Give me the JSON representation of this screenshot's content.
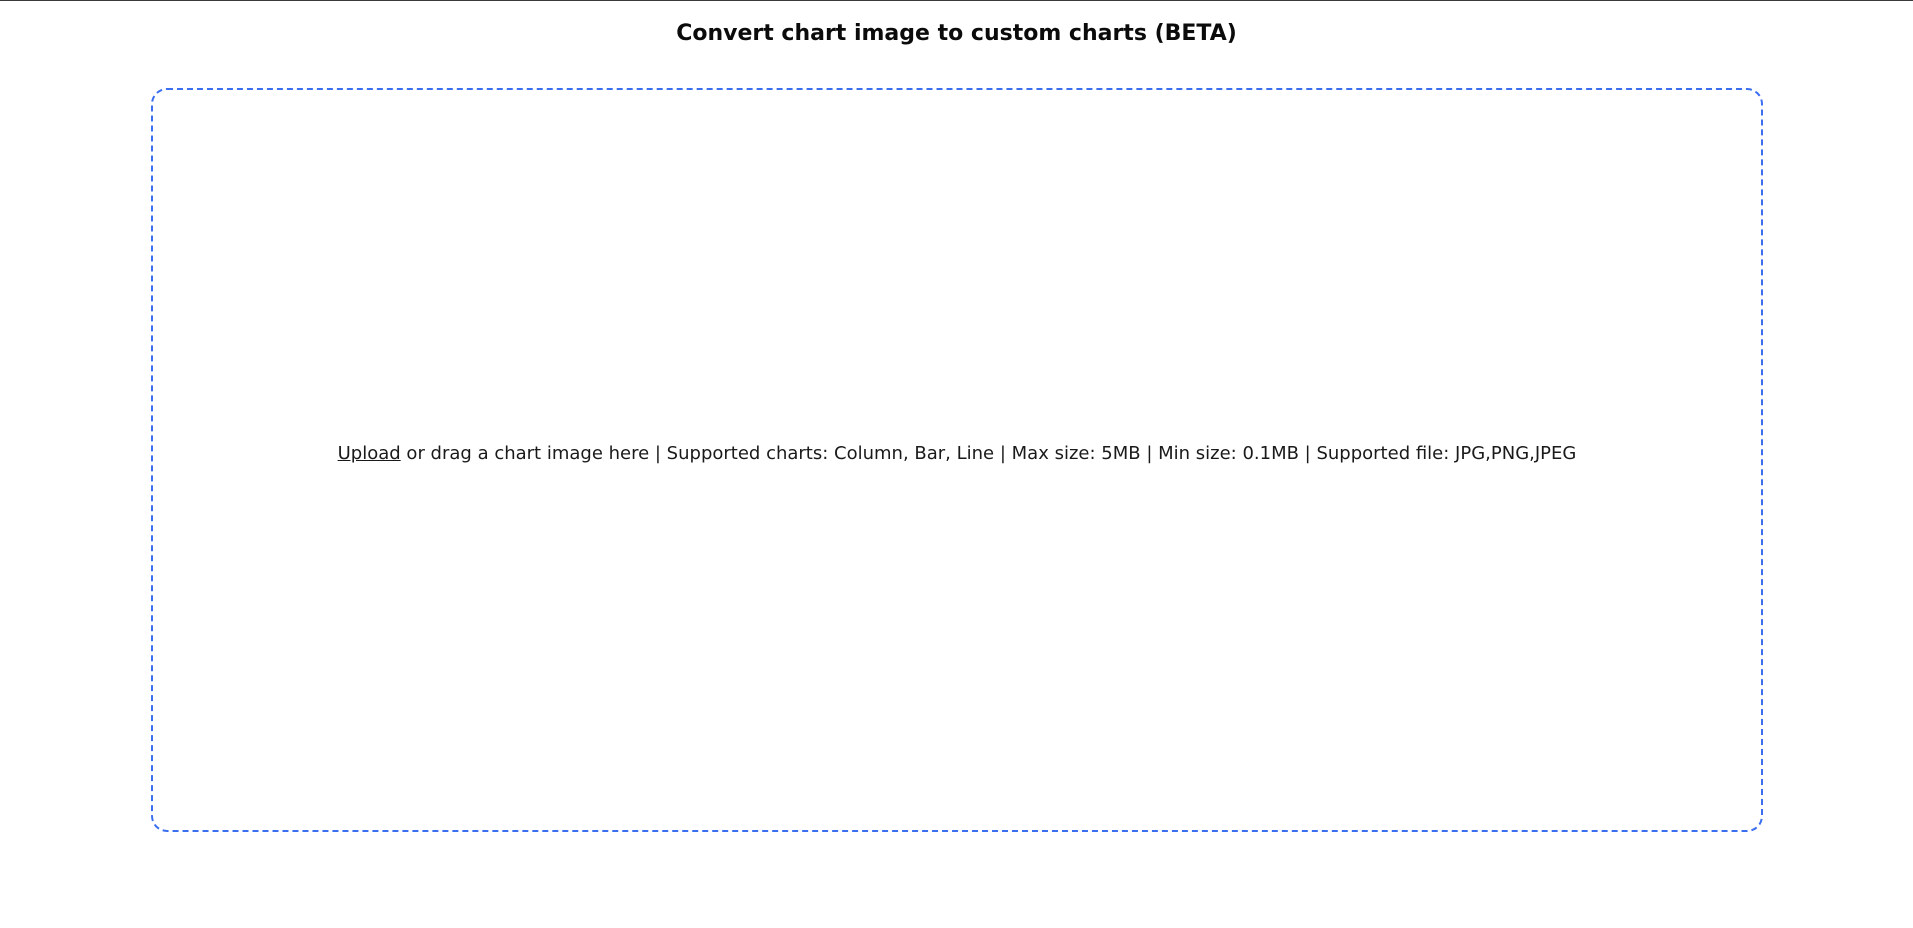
{
  "header": {
    "title": "Convert chart image to custom charts (BETA)"
  },
  "dropzone": {
    "upload_link": "Upload",
    "instructions": " or drag a chart image here | Supported charts: Column, Bar, Line | Max size: 5MB | Min size: 0.1MB | Supported file: JPG,PNG,JPEG",
    "border_color": "#3b6ff0"
  }
}
